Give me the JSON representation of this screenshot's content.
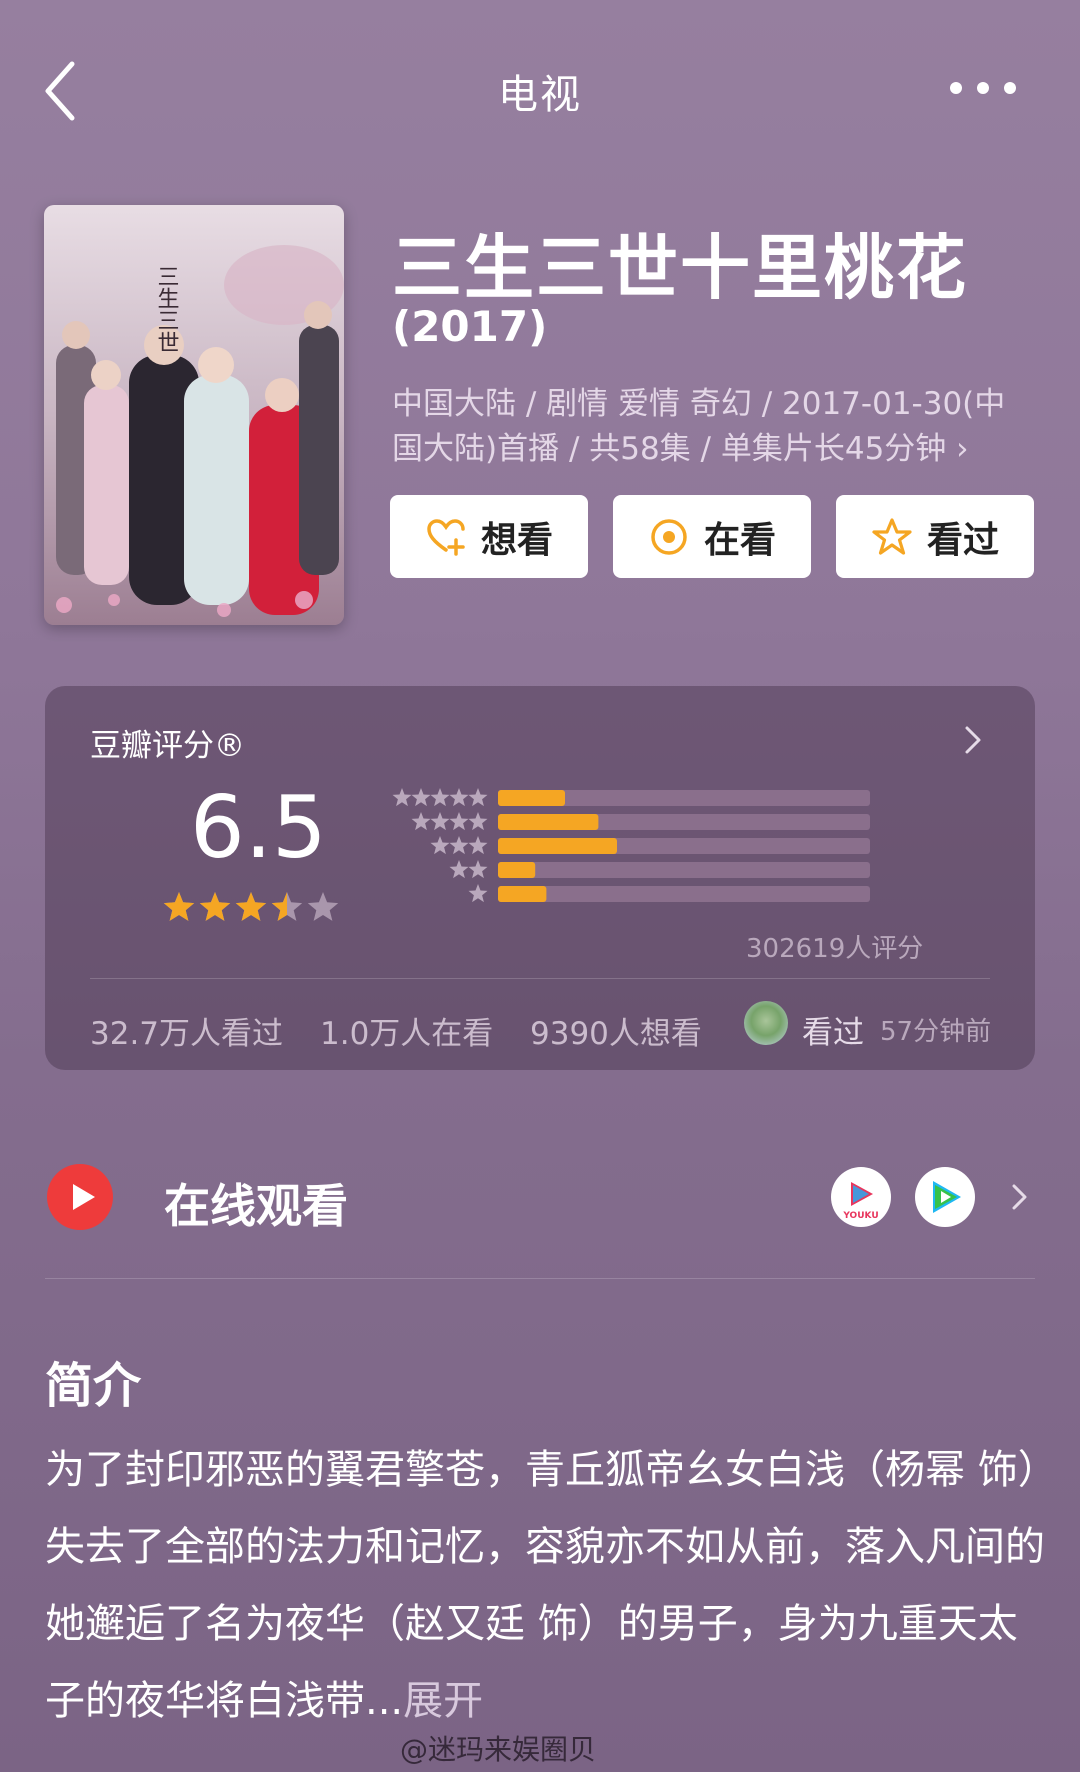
{
  "top_bar": {
    "title": "电视",
    "back_icon": "back-chevron-icon",
    "more_icon": "more-dots-icon"
  },
  "show": {
    "title": "三生三世十里桃花",
    "year": "(2017)",
    "meta_line1": "中国大陆 / 剧情 爱情 奇幻 / 2017-01-30(中",
    "meta_line2": "国大陆)首播 / 共58集 / 单集片长45分钟 ›",
    "poster_title": "三生三世十里桃花"
  },
  "actions": [
    {
      "label": "想看",
      "icon": "heart-plus-icon"
    },
    {
      "label": "在看",
      "icon": "target-icon"
    },
    {
      "label": "看过",
      "icon": "star-icon"
    }
  ],
  "rating": {
    "label": "豆瓣评分®",
    "score": "6.5",
    "stars_filled": 3.5,
    "stars_total": 5,
    "rating_count": "302619人评分",
    "distribution": [
      {
        "stars": 5,
        "fraction": 0.18
      },
      {
        "stars": 4,
        "fraction": 0.27
      },
      {
        "stars": 3,
        "fraction": 0.32
      },
      {
        "stars": 2,
        "fraction": 0.1
      },
      {
        "stars": 1,
        "fraction": 0.13
      }
    ],
    "stats": {
      "watched": "32.7万人看过",
      "watching": "1.0万人在看",
      "want": "9390人想看"
    },
    "friend": {
      "action": "看过",
      "time": "57分钟前"
    }
  },
  "online": {
    "label": "在线观看",
    "platforms": [
      {
        "name": "YOUKU",
        "icon": "youku-icon"
      },
      {
        "name": "Tencent Video",
        "icon": "tencent-video-icon"
      }
    ]
  },
  "intro": {
    "heading": "简介",
    "text": "为了封印邪恶的翼君擎苍，青丘狐帝幺女白浅（杨幂 饰）失去了全部的法力和记忆，容貌亦不如从前，落入凡间的她邂逅了名为夜华（赵又廷 饰）的男子，身为九重天太子的夜华将白浅带...",
    "more": "展开"
  },
  "watermark": "@迷玛来娱圈贝",
  "colors": {
    "accent_orange": "#f5a623",
    "bar_track": "#8a6f8c",
    "brand_red": "#ee3b3b"
  }
}
